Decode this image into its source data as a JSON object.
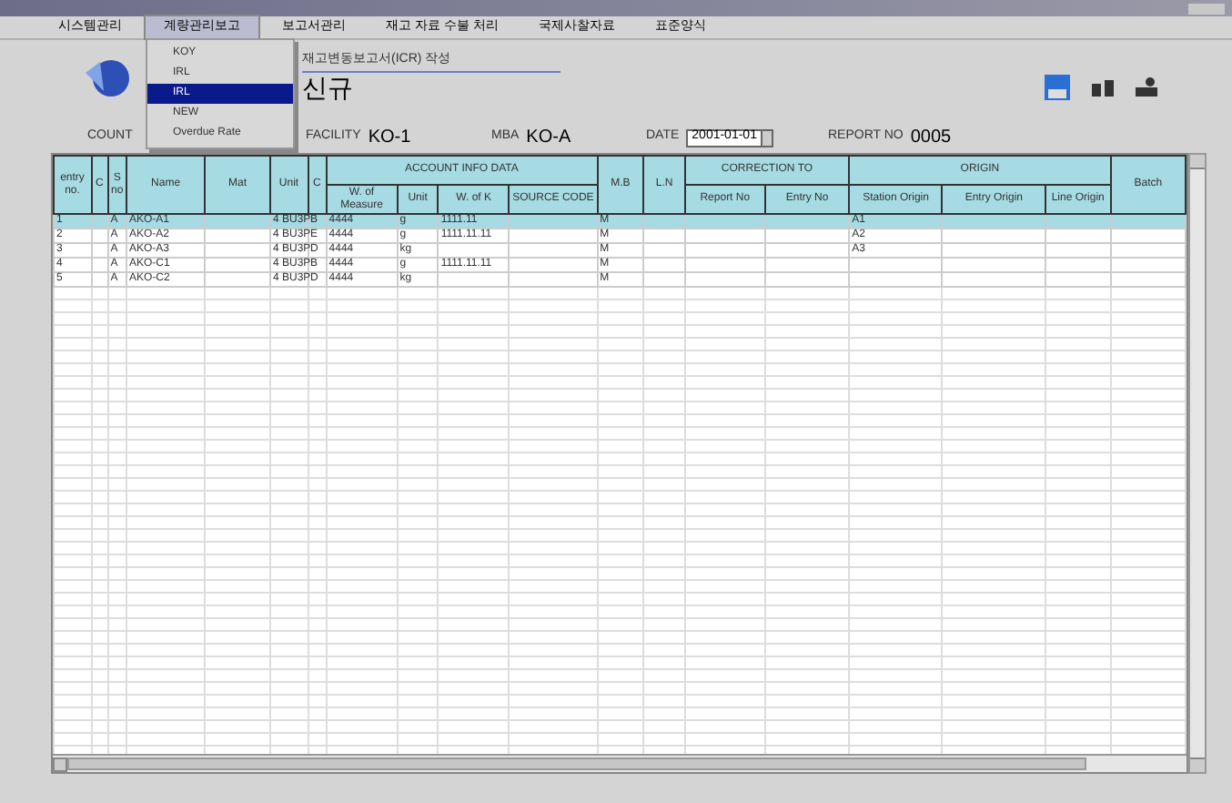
{
  "menu_bar": [
    {
      "label": "시스템관리",
      "selected": false
    },
    {
      "label": "계량관리보고",
      "selected": true
    },
    {
      "label": "보고서관리",
      "selected": false
    },
    {
      "label": "재고 자료 수불 처리",
      "selected": false
    },
    {
      "label": "국제사찰자료",
      "selected": false
    },
    {
      "label": "표준양식",
      "selected": false
    }
  ],
  "dropdown": [
    {
      "label": "KOY",
      "selected": false
    },
    {
      "label": "IRL",
      "selected": false
    },
    {
      "label": "IRL",
      "selected": true
    },
    {
      "label": "NEW",
      "selected": false
    },
    {
      "label": "Overdue Rate",
      "selected": false
    }
  ],
  "header": {
    "subtitle": "재고변동보고서(ICR) 작성",
    "title": "신규",
    "fields": [
      {
        "label": "COUNT"
      },
      {
        "label": "FACILITY",
        "value": "KO-1"
      },
      {
        "label": "MBA",
        "value": "KO-A"
      },
      {
        "label": "DATE",
        "value": "2001-01-01",
        "kind": "spin"
      },
      {
        "label": "REPORT NO",
        "value": "0005"
      }
    ]
  },
  "table": {
    "header": [
      {
        "label": "entry no."
      },
      {
        "label": "C"
      },
      {
        "label": "S no"
      },
      {
        "label": "Name"
      },
      {
        "label": "Mat"
      },
      {
        "label": "Unit"
      },
      {
        "label": "C"
      },
      {
        "group": "ACCOUNT INFO DATA",
        "columns": [
          "W. of Measure",
          "Unit",
          "W. of K",
          "SOURCE CODE"
        ]
      },
      {
        "label": "M.B"
      },
      {
        "label": "L.N"
      },
      {
        "group": "CORRECTION TO",
        "columns": [
          "Report No",
          "Entry No"
        ]
      },
      {
        "group": "ORIGIN",
        "columns": [
          "Station Origin",
          "Entry Origin",
          "Line Origin"
        ]
      },
      {
        "label": "Batch"
      }
    ],
    "rows": [
      {
        "selected": true,
        "cells": [
          "1",
          "",
          "A",
          "AKO-A1",
          "",
          "4 BU3P",
          "B",
          "4444",
          "g",
          "1111.11",
          "",
          "M",
          "",
          "",
          "",
          "A1",
          "",
          "",
          ""
        ]
      },
      {
        "selected": false,
        "cells": [
          "2",
          "",
          "A",
          "AKO-A2",
          "",
          "4 BU3P",
          "E",
          "4444",
          "g",
          "1111.11.11",
          "",
          "M",
          "",
          "",
          "",
          "A2",
          "",
          "",
          ""
        ]
      },
      {
        "selected": false,
        "cells": [
          "3",
          "",
          "A",
          "AKO-A3",
          "",
          "4 BU3P",
          "D",
          "4444",
          "kg",
          "",
          "",
          "M",
          "",
          "",
          "",
          "A3",
          "",
          "",
          ""
        ]
      },
      {
        "selected": false,
        "cells": [
          "4",
          "",
          "A",
          "AKO-C1",
          "",
          "4 BU3P",
          "B",
          "4444",
          "g",
          "1111.11.11",
          "",
          "M",
          "",
          "",
          "",
          "",
          "",
          "",
          ""
        ]
      },
      {
        "selected": false,
        "cells": [
          "5",
          "",
          "A",
          "AKO-C2",
          "",
          "4 BU3P",
          "D",
          "4444",
          "kg",
          "",
          "",
          "M",
          "",
          "",
          "",
          "",
          "",
          "",
          ""
        ]
      }
    ]
  }
}
